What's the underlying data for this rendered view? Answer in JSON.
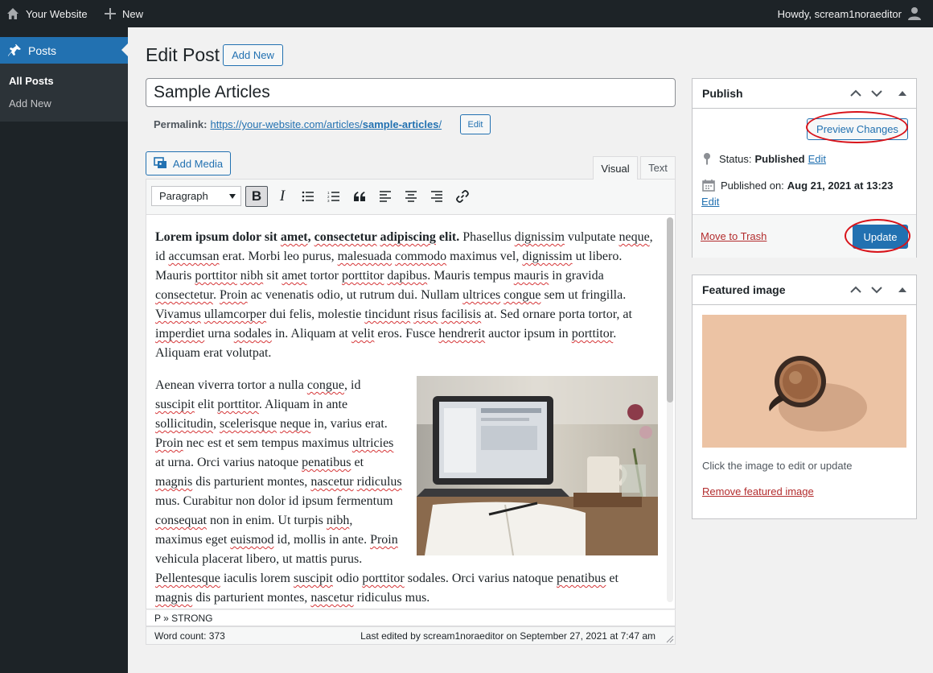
{
  "admin_bar": {
    "site_name": "Your Website",
    "new_label": "New",
    "howdy": "Howdy, scream1noraeditor",
    "icons": [
      "home-icon",
      "plus-icon",
      "user-avatar-icon"
    ]
  },
  "sidebar": {
    "menu_label": "Posts",
    "submenu": [
      {
        "label": "All Posts",
        "current": true
      },
      {
        "label": "Add New",
        "current": false
      }
    ]
  },
  "header": {
    "title": "Edit Post",
    "add_new_label": "Add New"
  },
  "post": {
    "title": "Sample Articles",
    "permalink_label": "Permalink:",
    "permalink_base": "https://your-website.com/articles/",
    "permalink_slug": "sample-articles",
    "permalink_trailing": "/",
    "permalink_edit_label": "Edit"
  },
  "editor": {
    "add_media_label": "Add Media",
    "tabs": [
      {
        "label": "Visual",
        "active": true
      },
      {
        "label": "Text",
        "active": false
      }
    ],
    "format_selected": "Paragraph",
    "toolbar_buttons": [
      "bold-icon",
      "italic-icon",
      "bullet-list-icon",
      "numbered-list-icon",
      "blockquote-icon",
      "align-left-icon",
      "align-center-icon",
      "align-right-icon",
      "link-icon"
    ],
    "path": "P » STRONG",
    "word_count": "Word count: 373",
    "last_edited": "Last edited by scream1noraeditor on September 27, 2021 at 7:47 am",
    "content_image": "laptop-desk-photo"
  },
  "publish": {
    "title": "Publish",
    "preview_label": "Preview Changes",
    "status_label": "Status:",
    "status_value": "Published",
    "status_edit": "Edit",
    "published_label": "Published on:",
    "published_value": "Aug 21, 2021 at 13:23",
    "published_edit": "Edit",
    "trash_label": "Move to Trash",
    "update_label": "Update"
  },
  "featured": {
    "title": "Featured image",
    "hint": "Click the image to edit or update",
    "remove_label": "Remove featured image",
    "image": "coffee-cup-photo"
  },
  "colors": {
    "primary": "#2271b1",
    "admin_bar": "#1d2327",
    "danger": "#b32d2e",
    "annotation": "#d8131a"
  }
}
